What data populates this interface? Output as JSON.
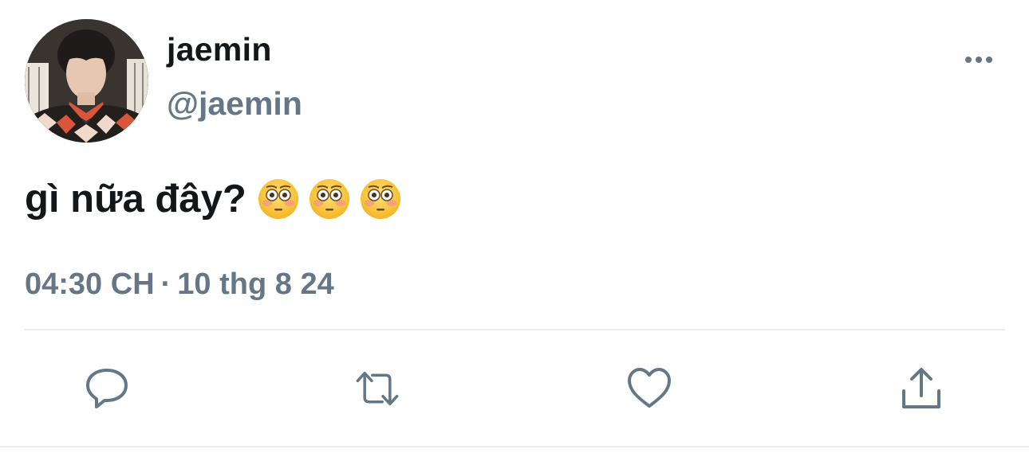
{
  "author": {
    "display_name": "jaemin",
    "handle": "@jaemin"
  },
  "tweet": {
    "text": "gì nữa đây?",
    "emojis": [
      "flushed-face",
      "flushed-face",
      "flushed-face"
    ]
  },
  "meta": {
    "time": "04:30 CH",
    "separator": "·",
    "date": "10 thg 8 24"
  },
  "actions": {
    "reply_icon": "reply-icon",
    "retweet_icon": "retweet-icon",
    "like_icon": "heart-icon",
    "share_icon": "share-icon"
  },
  "colors": {
    "text_primary": "#14171a",
    "text_secondary": "#657786",
    "divider": "#e6ecf0"
  }
}
